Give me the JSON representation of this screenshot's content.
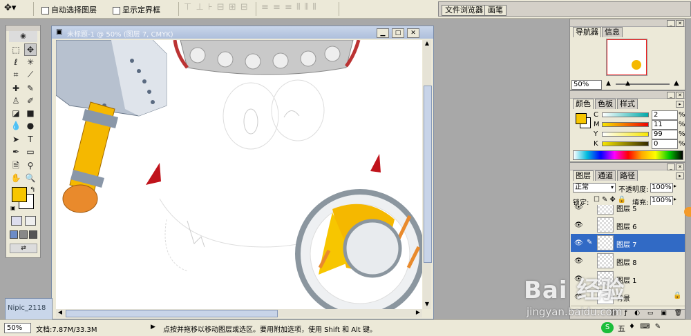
{
  "options_bar": {
    "auto_select_label": "自动选择图层",
    "show_bounds_label": "显示定界框",
    "well_tabs": [
      "文件浏览器",
      "画笔"
    ]
  },
  "toolbox": {
    "tools": [
      "lasso-icon",
      "move-icon",
      "marquee-icon",
      "magic-wand-icon",
      "crop-icon",
      "slice-icon",
      "healing-icon",
      "brush-icon",
      "stamp-icon",
      "history-brush-icon",
      "eraser-icon",
      "gradient-icon",
      "blur-icon",
      "dodge-icon",
      "path-select-icon",
      "text-icon",
      "pen-icon",
      "shape-icon",
      "notes-icon",
      "eyedropper-icon",
      "hand-icon",
      "zoom-icon"
    ],
    "foreground_color": "#f7c600",
    "background_color": "#ffffff"
  },
  "document": {
    "title": "未标题-1 @ 50% (图层 7, CMYK)",
    "minimized_title": "Nipic_2118"
  },
  "status_bar": {
    "zoom": "50%",
    "doc_size": "文档:7.87M/33.3M",
    "hint": "点按并拖移以移动图层或选区。要用附加选项，使用 Shift 和 Alt 键。"
  },
  "navigator_panel": {
    "tabs": [
      "导航器",
      "信息"
    ],
    "zoom": "50%"
  },
  "color_panel": {
    "tabs": [
      "颜色",
      "色板",
      "样式"
    ],
    "channels": [
      {
        "label": "C",
        "value": "2",
        "unit": "%"
      },
      {
        "label": "M",
        "value": "11",
        "unit": "%"
      },
      {
        "label": "Y",
        "value": "99",
        "unit": "%"
      },
      {
        "label": "K",
        "value": "0",
        "unit": "%"
      }
    ]
  },
  "layers_panel": {
    "tabs": [
      "图层",
      "通道",
      "路径"
    ],
    "blend_mode": "正常",
    "opacity_label": "不透明度:",
    "opacity": "100%",
    "lock_label": "锁定:",
    "fill_label": "填充:",
    "fill": "100%",
    "layers": [
      {
        "name": "图层 5",
        "selected": false
      },
      {
        "name": "图层 6",
        "selected": false
      },
      {
        "name": "图层 7",
        "selected": true
      },
      {
        "name": "图层 8",
        "selected": false
      },
      {
        "name": "图层 1",
        "selected": false
      },
      {
        "name": "背景",
        "selected": false
      }
    ]
  },
  "watermark": {
    "brand": "Bai 经验",
    "url": "jingyan.baidu.com"
  },
  "taskbar": {
    "ime_label": "五"
  }
}
